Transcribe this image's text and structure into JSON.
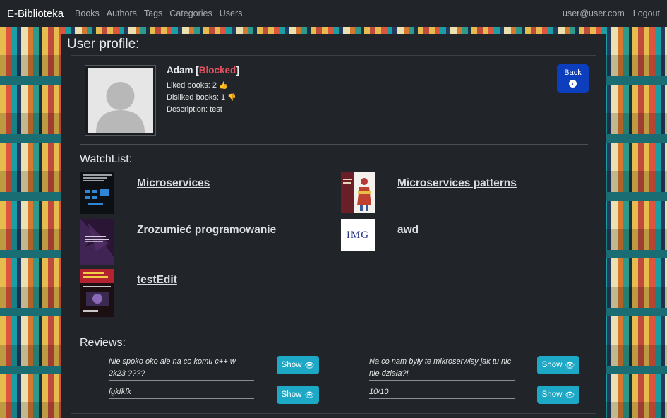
{
  "nav": {
    "brand": "E-Biblioteka",
    "links": [
      "Books",
      "Authors",
      "Tags",
      "Categories",
      "Users"
    ],
    "user_email": "user@user.com",
    "logout": "Logout"
  },
  "page": {
    "title": "User profile:"
  },
  "profile": {
    "name": "Adam",
    "status": "Blocked",
    "liked": "Liked books: 2",
    "disliked": "Disliked books: 1",
    "description": "Description: test",
    "back_label": "Back"
  },
  "watchlist": {
    "title": "WatchList:",
    "items": [
      {
        "title": "Microservices"
      },
      {
        "title": "Microservices patterns"
      },
      {
        "title": "Zrozumieć programowanie"
      },
      {
        "title": "awd",
        "cover_text": "IMG"
      },
      {
        "title": "testEdit"
      }
    ]
  },
  "reviews": {
    "title": "Reviews:",
    "show_label": "Show",
    "items": [
      {
        "text": "Nie spoko oko ale na co komu c++ w 2k23 ????"
      },
      {
        "text": "Na co nam były te mikroserwisy jak tu nic nie działa?!"
      },
      {
        "text": "fgkfkfk"
      },
      {
        "text": "10/10"
      }
    ]
  },
  "colors": {
    "navbar": "#212529",
    "panel": "#212529",
    "blocked": "#e05260",
    "back_button": "#0d3ebd",
    "show_button": "#1da8c6"
  }
}
